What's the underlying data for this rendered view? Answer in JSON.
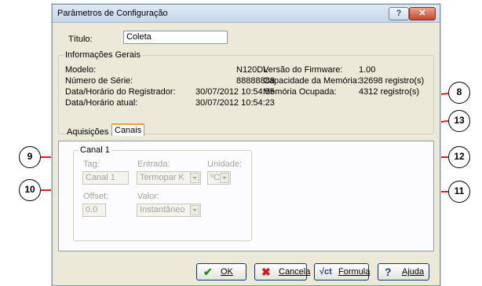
{
  "window": {
    "title": "Parâmetros de Configuração",
    "help_label": "?",
    "close_label": "✕"
  },
  "titulo": {
    "label": "Título:",
    "value": "Coleta"
  },
  "info": {
    "group_label": "Informações Gerais",
    "modelo_label": "Modelo:",
    "modelo_value": "N120DL",
    "serie_label": "Número de Série:",
    "serie_value": "88888888",
    "registrador_label": "Data/Horário do Registrador:",
    "registrador_value": "30/07/2012 10:54:55",
    "atual_label": "Data/Horário atual:",
    "atual_value": "30/07/2012 10:54:23",
    "firmware_label": "Versão do Firmware:",
    "firmware_value": "1.00",
    "capacidade_label": "Capacidade da Memória:",
    "capacidade_value": "32698 registro(s)",
    "ocupada_label": "Memória Ocupada:",
    "ocupada_value": "4312 registro(s)"
  },
  "tabs": [
    {
      "label": "Aquisições"
    },
    {
      "label": "Canais"
    }
  ],
  "canal": {
    "group_label": "Canal 1",
    "tag_label": "Tag:",
    "tag_value": "Canal 1",
    "entrada_label": "Entrada:",
    "entrada_value": "Termopar K",
    "unidade_label": "Unidade:",
    "unidade_value": "ºC",
    "offset_label": "Offset:",
    "offset_value": "0.0",
    "valor_label": "Valor:",
    "valor_value": "Instantâneo"
  },
  "buttons": {
    "ok": "OK",
    "ok_icon": "✔",
    "cancelar": "Cancela",
    "cancelar_icon": "✖",
    "formula": "Formula",
    "formula_icon": "√ct",
    "ajuda": "Ajuda",
    "ajuda_icon": "?"
  },
  "callouts": [
    "8",
    "13",
    "9",
    "12",
    "10",
    "11"
  ]
}
